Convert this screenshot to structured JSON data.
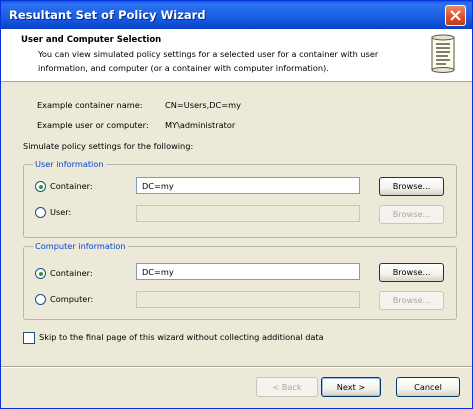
{
  "window": {
    "title": "Resultant Set of Policy Wizard"
  },
  "header": {
    "title": "User and Computer Selection",
    "description": "You can view simulated policy settings for a selected user for a container with user information, and computer (or a container with computer information)."
  },
  "example": {
    "container_label": "Example container name:",
    "container_value": "CN=Users,DC=my",
    "user_label": "Example user or computer:",
    "user_value": "MY\\administrator"
  },
  "simulate_label": "Simulate policy settings for the following:",
  "user_info": {
    "legend": "User information",
    "container_label": "Container:",
    "container_value": "DC=my",
    "container_selected": true,
    "user_label": "User:",
    "user_value": "",
    "browse_label": "Browse..."
  },
  "computer_info": {
    "legend": "Computer information",
    "container_label": "Container:",
    "container_value": "DC=my",
    "container_selected": true,
    "computer_label": "Computer:",
    "computer_value": "",
    "browse_label": "Browse..."
  },
  "skip_checkbox": {
    "label": "Skip to the final page of this wizard without collecting additional data",
    "checked": false
  },
  "buttons": {
    "back": "< Back",
    "next": "Next >",
    "cancel": "Cancel"
  },
  "colors": {
    "title_bar": "#0a5ae8",
    "group_legend": "#0046d5",
    "radio_dot": "#21a121",
    "window_bg": "#ece9d8"
  }
}
